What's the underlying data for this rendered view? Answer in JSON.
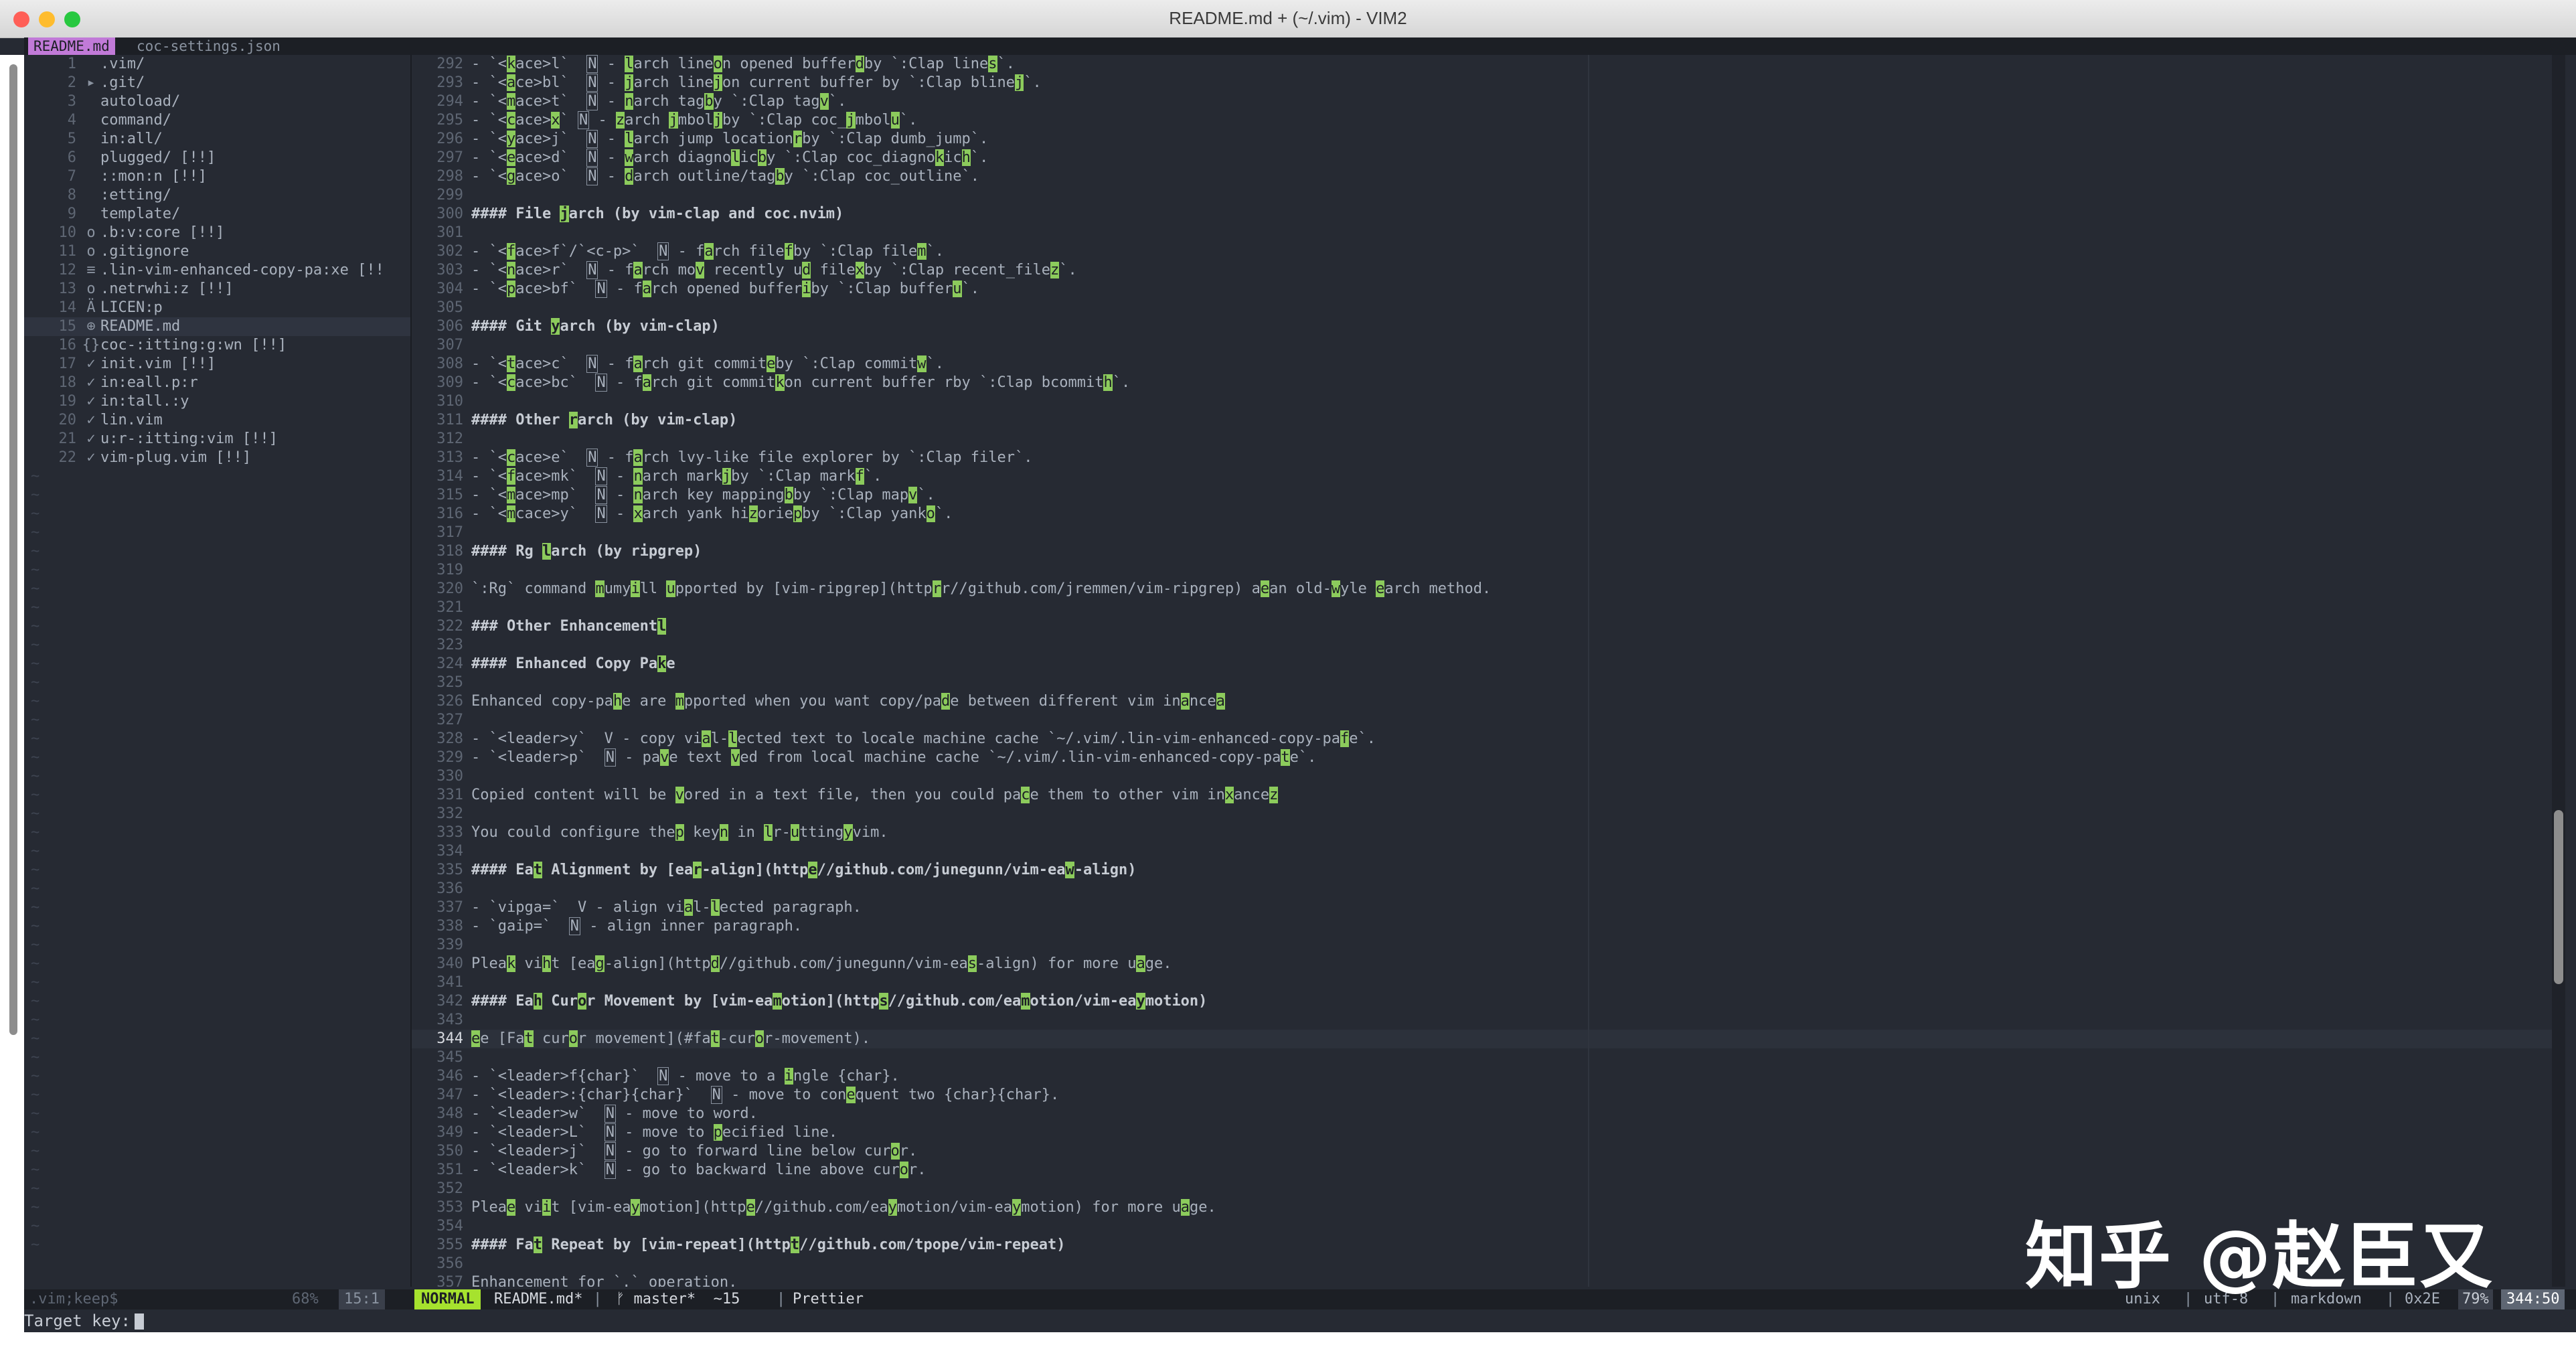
{
  "window": {
    "title": "README.md + (~/.vim) - VIM2",
    "traffic_lights": {
      "close": "#ff5f57",
      "minimize": "#febc2e",
      "zoom": "#28c840"
    }
  },
  "tabs": [
    {
      "label": "README.md",
      "active": true
    },
    {
      "label": "coc-settings.json",
      "active": false
    }
  ],
  "colors": {
    "accent": "#c17ad8",
    "mode": "#a6e22e",
    "match": "#8ccb5c",
    "bg": "#262a33"
  },
  "tree": {
    "rows": [
      {
        "num": "1",
        "icon": "",
        "name": ".vim/"
      },
      {
        "num": "2",
        "icon": "▸",
        "name": ".git/"
      },
      {
        "num": "3",
        "icon": "",
        "name": "autoload/"
      },
      {
        "num": "4",
        "icon": "",
        "name": "command/"
      },
      {
        "num": "5",
        "icon": "",
        "name": "in:all/"
      },
      {
        "num": "6",
        "icon": "",
        "name": "plugged/ [!!]"
      },
      {
        "num": "7",
        "icon": "",
        "name": "::mon:n [!!]"
      },
      {
        "num": "8",
        "icon": "",
        "name": ":etting/"
      },
      {
        "num": "9",
        "icon": "",
        "name": "template/"
      },
      {
        "num": "10",
        "icon": "o",
        "name": ".b:v:core [!!]"
      },
      {
        "num": "11",
        "icon": "o",
        "name": ".gitignore"
      },
      {
        "num": "12",
        "icon": "≡",
        "name": ".lin-vim-enhanced-copy-pa:xe [!!"
      },
      {
        "num": "13",
        "icon": "o",
        "name": ".netrwhi:z [!!]"
      },
      {
        "num": "14",
        "icon": "Ä",
        "name": "LICEN:p"
      },
      {
        "num": "15",
        "icon": "⊕",
        "name": "README.md"
      },
      {
        "num": "16",
        "icon": "{}",
        "name": "coc-:itting:g:wn [!!]"
      },
      {
        "num": "17",
        "icon": "✓",
        "name": "init.vim [!!]"
      },
      {
        "num": "18",
        "icon": "✓",
        "name": "in:eall.p:r"
      },
      {
        "num": "19",
        "icon": "✓",
        "name": "in:tall.:y"
      },
      {
        "num": "20",
        "icon": "✓",
        "name": "lin.vim"
      },
      {
        "num": "21",
        "icon": "✓",
        "name": "u:r-:itting:vim [!!]"
      },
      {
        "num": "22",
        "icon": "✓",
        "name": "vim-plug.vim [!!]"
      }
    ],
    "status_left": ".vim;keep$",
    "status_pct": "68%",
    "status_pos": "15:1"
  },
  "editor": {
    "lines": [
      {
        "n": "292",
        "t": "- `<:kace>l`  N - :larch line:on opened buffer:dby `:Clap line:s`."
      },
      {
        "n": "293",
        "t": "- `<:ace>bl`  N - :jarch line:jon current buffer by `:Clap bline:j`."
      },
      {
        "n": "294",
        "t": "- `<:mace>t`  N - :narch tag:by `:Clap tag:v`."
      },
      {
        "n": "295",
        "t": "- `<:cace>:x` N - :zarch :jmbol:jby `:Clap coc_:jmbol:u`."
      },
      {
        "n": "296",
        "t": "- `<:yace>j`  N - :larch jump location:rby `:Clap dumb_jump`."
      },
      {
        "n": "297",
        "t": "- `<:eace>d`  N - :warch diagno:lic:by `:Clap coc_diagno:kic:h`."
      },
      {
        "n": "298",
        "t": "- `<:gace>o`  N - :darch outline/tag:by `:Clap coc_outline`."
      },
      {
        "n": "299",
        "t": ""
      },
      {
        "n": "300",
        "t": "#### File :jarch (by vim-clap and coc.nvim)",
        "h": true
      },
      {
        "n": "301",
        "t": ""
      },
      {
        "n": "302",
        "t": "- `<:face>f`/`<c-p>`  N - f:arch file:fby `:Clap file:m`."
      },
      {
        "n": "303",
        "t": "- `<:nace>r`  N - f:arch mo:v recently u:d file:xby `:Clap recent_file:z`."
      },
      {
        "n": "304",
        "t": "- `<:pace>bf`  N - f:arch opened buffer:iby `:Clap buffer:u`."
      },
      {
        "n": "305",
        "t": ""
      },
      {
        "n": "306",
        "t": "#### Git :yarch (by vim-clap)",
        "h": true
      },
      {
        "n": "307",
        "t": ""
      },
      {
        "n": "308",
        "t": "- `<:tace>c`  N - f:arch git commit:eby `:Clap commit:w`."
      },
      {
        "n": "309",
        "t": "- `<:cace>bc`  N - f:arch git commit:kon current buffer rby `:Clap bcommit:h`."
      },
      {
        "n": "310",
        "t": ""
      },
      {
        "n": "311",
        "t": "#### Other :rarch (by vim-clap)",
        "h": true
      },
      {
        "n": "312",
        "t": ""
      },
      {
        "n": "313",
        "t": "- `<:cace>e`  N - f:arch lvy-like file explorer by `:Clap filer`."
      },
      {
        "n": "314",
        "t": "- `<:face>mk`  N - :narch mark:jby `:Clap mark:f`."
      },
      {
        "n": "315",
        "t": "- `<:mace>mp`  N - :narch key mapping:bby `:Clap map:v`."
      },
      {
        "n": "316",
        "t": "- `<:mcace>y`  N - :xarch yank hi:zorie:pby `:Clap yank:o`."
      },
      {
        "n": "317",
        "t": ""
      },
      {
        "n": "318",
        "t": "#### Rg :larch (by ripgrep)",
        "h": true
      },
      {
        "n": "319",
        "t": ""
      },
      {
        "n": "320",
        "t": "`:Rg` command :mumy:ill :upported by [vim-ripgrep](http:rr//github.com/jremmen/vim-ripgrep) a:ean old-:wyle :earch method."
      },
      {
        "n": "321",
        "t": ""
      },
      {
        "n": "322",
        "t": "### Other Enhancement:l",
        "h": true
      },
      {
        "n": "323",
        "t": ""
      },
      {
        "n": "324",
        "t": "#### Enhanced Copy Pa:ke",
        "h": true
      },
      {
        "n": "325",
        "t": ""
      },
      {
        "n": "326",
        "t": "Enhanced copy-pa:he are :mpported when you want copy/pa:de between different vim in:ance:a"
      },
      {
        "n": "327",
        "t": ""
      },
      {
        "n": "328",
        "t": "- `<leader>y`  V - copy vi:al-:lected text to locale machine cache `~/.vim/.lin-vim-enhanced-copy-pa:fe`."
      },
      {
        "n": "329",
        "t": "- `<leader>p`  N - pa:ve text :ved from local machine cache `~/.vim/.lin-vim-enhanced-copy-pa:te`."
      },
      {
        "n": "330",
        "t": ""
      },
      {
        "n": "331",
        "t": "Copied content will be :vored in a text file, then you could pa:ce them to other vim in:xance:z"
      },
      {
        "n": "332",
        "t": ""
      },
      {
        "n": "333",
        "t": "You could configure the:p key:n in :lr-:utting:yvim."
      },
      {
        "n": "334",
        "t": ""
      },
      {
        "n": "335",
        "t": "#### Ea:t Alignment by [ea:r-align](http:e//github.com/junegunn/vim-ea:w-align)",
        "h": true
      },
      {
        "n": "336",
        "t": ""
      },
      {
        "n": "337",
        "t": "- `vipga=`  V - align vi:al-:lected paragraph."
      },
      {
        "n": "338",
        "t": "- `gaip=`  N - align inner paragraph."
      },
      {
        "n": "339",
        "t": ""
      },
      {
        "n": "340",
        "t": "Plea:k vi:ht [ea:g-align](http:d//github.com/junegunn/vim-ea:s-align) for more u:age."
      },
      {
        "n": "341",
        "t": ""
      },
      {
        "n": "342",
        "t": "#### Ea:h Cur:or Movement by [vim-ea:motion](http:s//github.com/ea:motion/vim-ea:ymotion)",
        "h": true
      },
      {
        "n": "343",
        "t": ""
      },
      {
        "n": "344",
        "t": ":ee [Fa:t cur:or movement](#fa:t-cur:or-movement).",
        "cur": true
      },
      {
        "n": "345",
        "t": ""
      },
      {
        "n": "346",
        "t": "- `<leader>f{char}`  N - move to a :ingle {char}."
      },
      {
        "n": "347",
        "t": "- `<leader>:{char}{char}`  N - move to con:equent two {char}{char}."
      },
      {
        "n": "348",
        "t": "- `<leader>w`  N - move to word."
      },
      {
        "n": "349",
        "t": "- `<leader>L`  N - move to :pecified line."
      },
      {
        "n": "350",
        "t": "- `<leader>j`  N - go to forward line below cur:or."
      },
      {
        "n": "351",
        "t": "- `<leader>k`  N - go to backward line above cur:or."
      },
      {
        "n": "352",
        "t": ""
      },
      {
        "n": "353",
        "t": "Plea:e vi:it [vim-ea:ymotion](http:e//github.com/ea:ymotion/vim-ea:ymotion) for more u:age."
      },
      {
        "n": "354",
        "t": ""
      },
      {
        "n": "355",
        "t": "#### Fa:t Repeat by [vim-repeat](http:t//github.com/tpope/vim-repeat)",
        "h": true
      },
      {
        "n": "356",
        "t": ""
      },
      {
        "n": "357",
        "t": "Enhancement for `.` operation."
      }
    ]
  },
  "statusline": {
    "mode": "NORMAL",
    "file": "README.md*",
    "branch": "ᚠ master*  ~15",
    "formatter": "Prettier",
    "format": "unix",
    "encoding": "utf-8",
    "filetype": "markdown",
    "char": "0x2E",
    "percent": "79%",
    "position": "344:50"
  },
  "cmdline": {
    "prompt": "Target key:"
  },
  "watermark": {
    "text": "知乎 @赵臣又"
  }
}
